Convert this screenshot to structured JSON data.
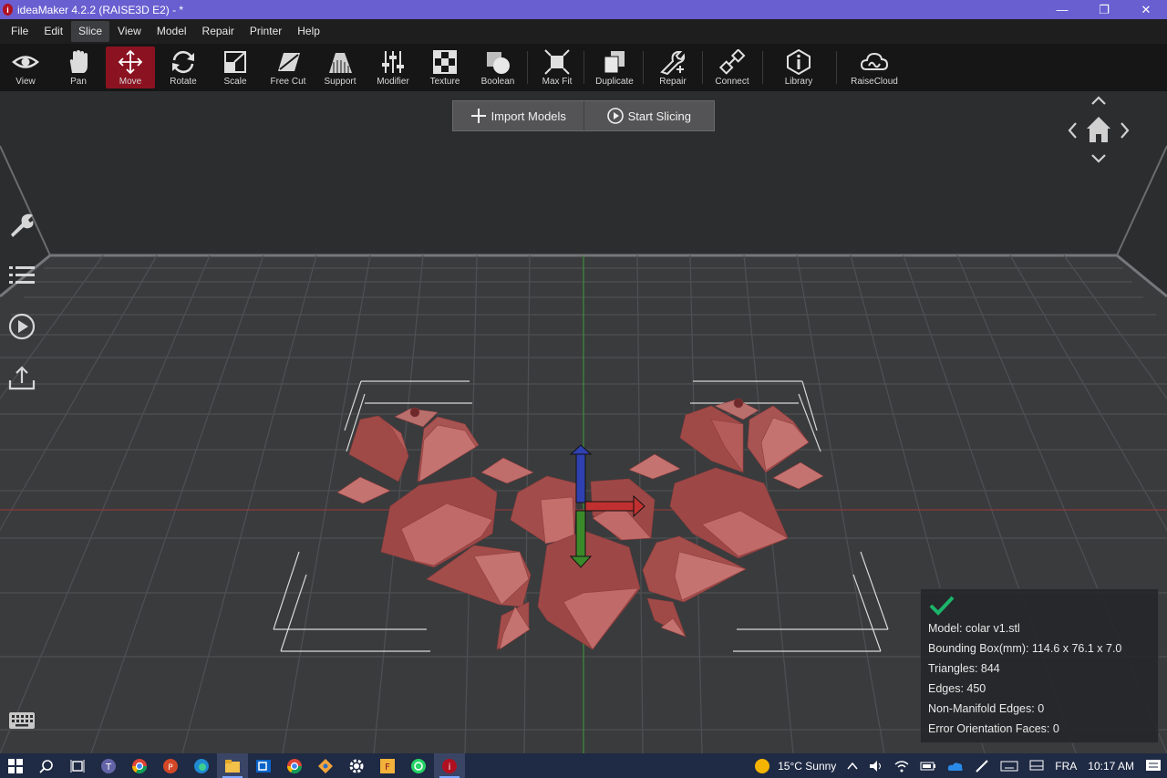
{
  "window": {
    "title": "ideaMaker 4.2.2 (RAISE3D E2) - *",
    "controls": [
      "minimize",
      "restore",
      "close"
    ]
  },
  "menu": {
    "items": [
      "File",
      "Edit",
      "Slice",
      "View",
      "Model",
      "Repair",
      "Printer",
      "Help"
    ],
    "active": "Slice"
  },
  "toolbar": {
    "tools": [
      {
        "label": "View",
        "icon": "eye-icon"
      },
      {
        "label": "Pan",
        "icon": "hand-icon"
      },
      {
        "label": "Move",
        "icon": "move-icon",
        "active": true
      },
      {
        "label": "Rotate",
        "icon": "rotate-icon"
      },
      {
        "label": "Scale",
        "icon": "scale-icon"
      },
      {
        "label": "Free Cut",
        "icon": "free-cut-icon"
      },
      {
        "label": "Support",
        "icon": "support-icon"
      },
      {
        "label": "Modifier",
        "icon": "modifier-icon"
      },
      {
        "label": "Texture",
        "icon": "texture-icon"
      },
      {
        "label": "Boolean",
        "icon": "boolean-icon"
      },
      {
        "label": "Max Fit",
        "icon": "max-fit-icon"
      },
      {
        "label": "Duplicate",
        "icon": "duplicate-icon"
      },
      {
        "label": "Repair",
        "icon": "repair-icon"
      },
      {
        "label": "Connect",
        "icon": "connect-icon"
      },
      {
        "label": "Library",
        "icon": "library-icon"
      },
      {
        "label": "RaiseCloud",
        "icon": "cloud-icon"
      }
    ]
  },
  "actions": {
    "import_label": "Import Models",
    "slice_label": "Start Slicing"
  },
  "model_info": {
    "model": "Model: colar v1.stl",
    "bounding_box": "Bounding Box(mm): 114.6 x 76.1 x 7.0",
    "triangles": "Triangles: 844",
    "edges": "Edges: 450",
    "non_manifold": "Non-Manifold Edges: 0",
    "error_faces": "Error Orientation Faces: 0"
  },
  "colors": {
    "accent": "#8b1220",
    "model": "#a85554",
    "check": "#1bb56a",
    "title_bar": "#6a5fd0"
  },
  "taskbar": {
    "weather": "15°C  Sunny",
    "language": "FRA",
    "time": "10:17 AM"
  }
}
